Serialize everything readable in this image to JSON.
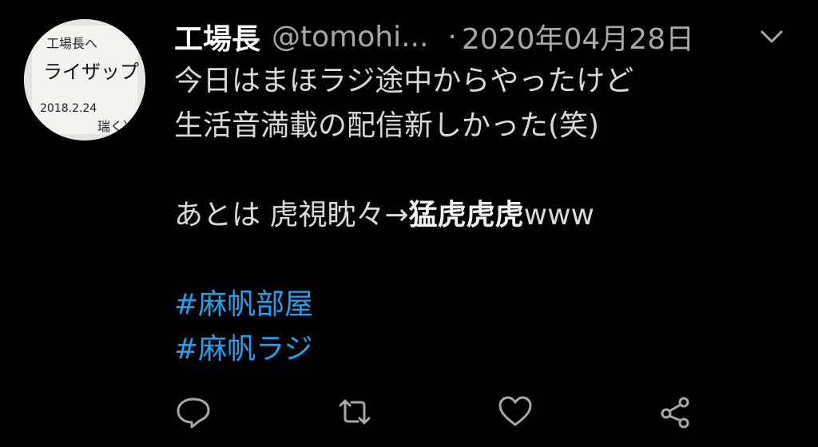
{
  "tweet": {
    "display_name": "工場長",
    "handle": "@tomohi...",
    "separator": "·",
    "date": "2020年04月28日",
    "avatar": {
      "line1": "工場長へ",
      "line2": "ライザップ",
      "line3": "2018.2.24",
      "line4": "瑞く〉"
    },
    "body": {
      "line1": "今日はまほラジ途中からやったけど",
      "line2": "生活音満載の配信新しかった(笑)",
      "line3_prefix": "あとは 虎視眈々→",
      "line3_bold": "猛虎虎虎",
      "line3_suffix": "www",
      "hashtag1": "#麻帆部屋",
      "hashtag2": "#麻帆ラジ"
    },
    "actions": {
      "reply_icon": "reply-icon",
      "retweet_icon": "retweet-icon",
      "like_icon": "like-icon",
      "share_icon": "share-icon"
    },
    "colors": {
      "background": "#000000",
      "text": "#d9d9d9",
      "muted": "#a8a8a8",
      "hashtag": "#1da1f2"
    }
  }
}
